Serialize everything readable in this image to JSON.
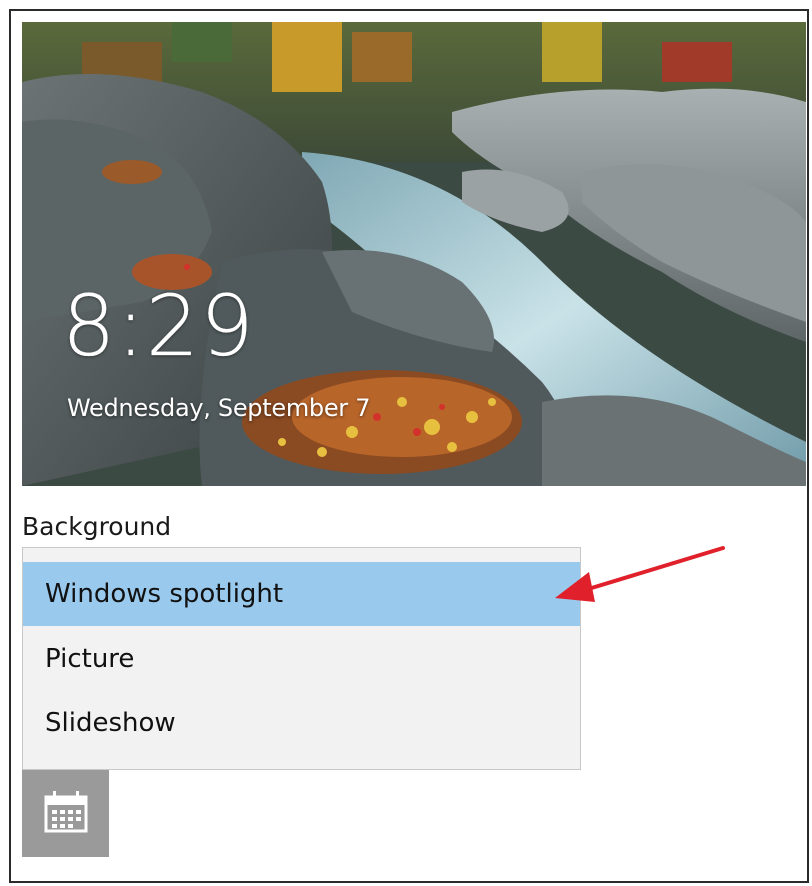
{
  "lockscreen": {
    "time": "8:29",
    "date": "Wednesday, September 7"
  },
  "background_section": {
    "label": "Background",
    "options": [
      {
        "label": "Windows spotlight",
        "selected": true
      },
      {
        "label": "Picture",
        "selected": false
      },
      {
        "label": "Slideshow",
        "selected": false
      }
    ],
    "selected_color": "#99c9ec"
  },
  "app_tile": {
    "icon": "calendar-icon"
  },
  "annotation": {
    "arrow_color": "#e0202a"
  }
}
